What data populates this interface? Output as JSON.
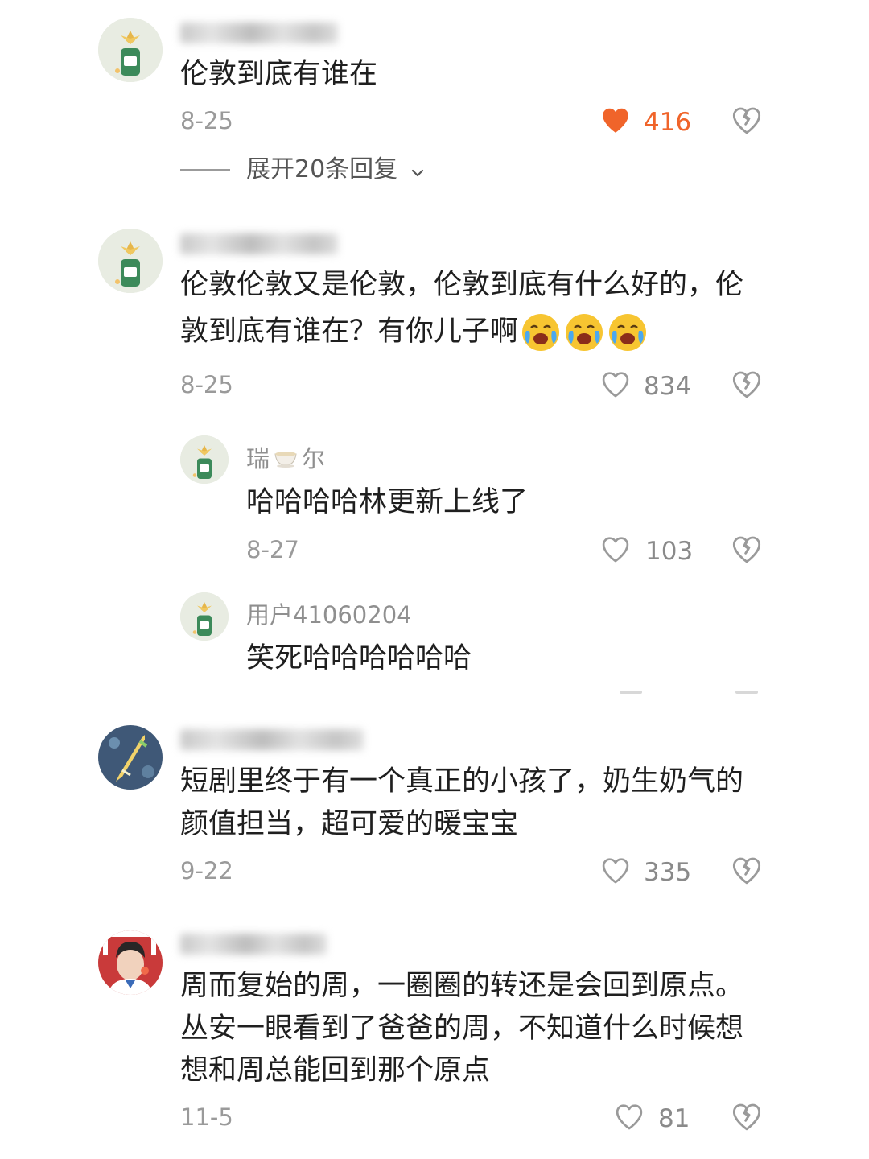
{
  "comments": [
    {
      "text": "伦敦到底有谁在",
      "date": "8-25",
      "likes": "416",
      "liked": true,
      "expand_label": "展开20条回复"
    },
    {
      "text_line1": "伦敦伦敦又是伦敦，伦敦到底有什么好的，伦",
      "text_line2": "敦到底有谁在？有你儿子啊",
      "emojis": [
        "crying-face",
        "crying-face",
        "crying-face"
      ],
      "date": "8-25",
      "likes": "834",
      "liked": false
    },
    {
      "text_line1": "短剧里终于有一个真正的小孩了，奶生奶气的",
      "text_line2": "颜值担当，超可爱的暖宝宝",
      "date": "9-22",
      "likes": "335",
      "liked": false
    },
    {
      "text_line1": "周而复始的周，一圈圈的转还是会回到原点。",
      "text_line2": "丛安一眼看到了爸爸的周，不知道什么时候想",
      "text_line3": "想和周总能回到那个原点",
      "date": "11-5",
      "likes": "81",
      "liked": false
    }
  ],
  "replies": [
    {
      "username_part1": "瑞",
      "username_icon": "teacup",
      "username_part2": "尔",
      "text": "哈哈哈哈林更新上线了",
      "date": "8-27",
      "likes": "103"
    },
    {
      "username": "用户41060204",
      "text": "笑死哈哈哈哈哈哈"
    }
  ],
  "colors": {
    "like_active": "#f0642a",
    "text_primary": "#1f1f1f",
    "text_secondary": "#9a9a9a"
  }
}
